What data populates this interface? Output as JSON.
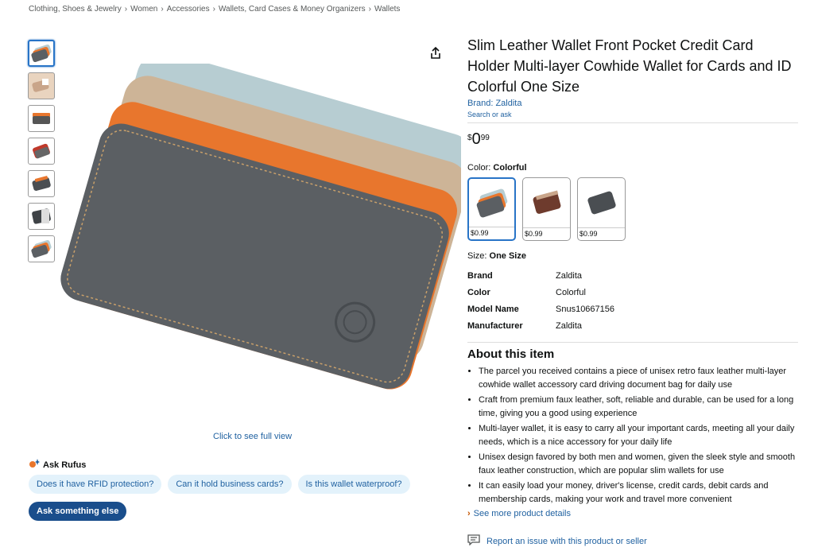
{
  "breadcrumb": [
    "Clothing, Shoes & Jewelry",
    "Women",
    "Accessories",
    "Wallets, Card Cases & Money Organizers",
    "Wallets"
  ],
  "breadcrumb_separator": "›",
  "product": {
    "title": "Slim Leather Wallet Front Pocket Credit Card Holder Multi-layer Cowhide Wallet for Cards and ID Colorful One Size",
    "brand_link": "Brand: Zaldita",
    "search_or_ask": "Search or ask",
    "price": {
      "symbol": "$",
      "whole": "0",
      "fraction": "99"
    }
  },
  "color": {
    "label": "Color: ",
    "value": "Colorful",
    "options": [
      {
        "name": "colorful",
        "price": "$0.99",
        "selected": true
      },
      {
        "name": "brown",
        "price": "$0.99",
        "selected": false
      },
      {
        "name": "gray",
        "price": "$0.99",
        "selected": false
      }
    ]
  },
  "size": {
    "label": "Size: ",
    "value": "One Size"
  },
  "specs": [
    {
      "key": "Brand",
      "value": "Zaldita"
    },
    {
      "key": "Color",
      "value": "Colorful"
    },
    {
      "key": "Model Name",
      "value": "Snus10667156"
    },
    {
      "key": "Manufacturer",
      "value": "Zaldita"
    }
  ],
  "about": {
    "title": "About this item",
    "bullets": [
      "The parcel you received contains a piece of unisex retro faux leather multi-layer cowhide wallet accessory card driving document bag for daily use",
      "Craft from premium faux leather, soft, reliable and durable, can be used for a long time, giving you a good using experience",
      "Multi-layer wallet, it is easy to carry all your important cards, meeting all your daily needs, which is a nice accessory for your daily life",
      "Unisex design favored by both men and women, given the sleek style and smooth faux leather construction, which are popular slim wallets for use",
      "It can easily load your money, driver's license, credit cards, debit cards and membership cards, making your work and travel more convenient"
    ],
    "see_more": "See more product details"
  },
  "report": "Report an issue with this product or seller",
  "gallery": {
    "full_view": "Click to see full view",
    "thumbnail_count": 7
  },
  "rufus": {
    "title": "Ask Rufus",
    "chips": [
      "Does it have RFID protection?",
      "Can it hold business cards?",
      "Is this wallet waterproof?"
    ],
    "ask_button": "Ask something else"
  },
  "colors": {
    "link": "#2162a1",
    "accent": "#c45500",
    "selected_border": "#2874c7",
    "wallet_gray": "#5b5f63",
    "wallet_orange": "#e8762d",
    "wallet_tan": "#cdb497",
    "wallet_blue": "#b7cdd2"
  }
}
